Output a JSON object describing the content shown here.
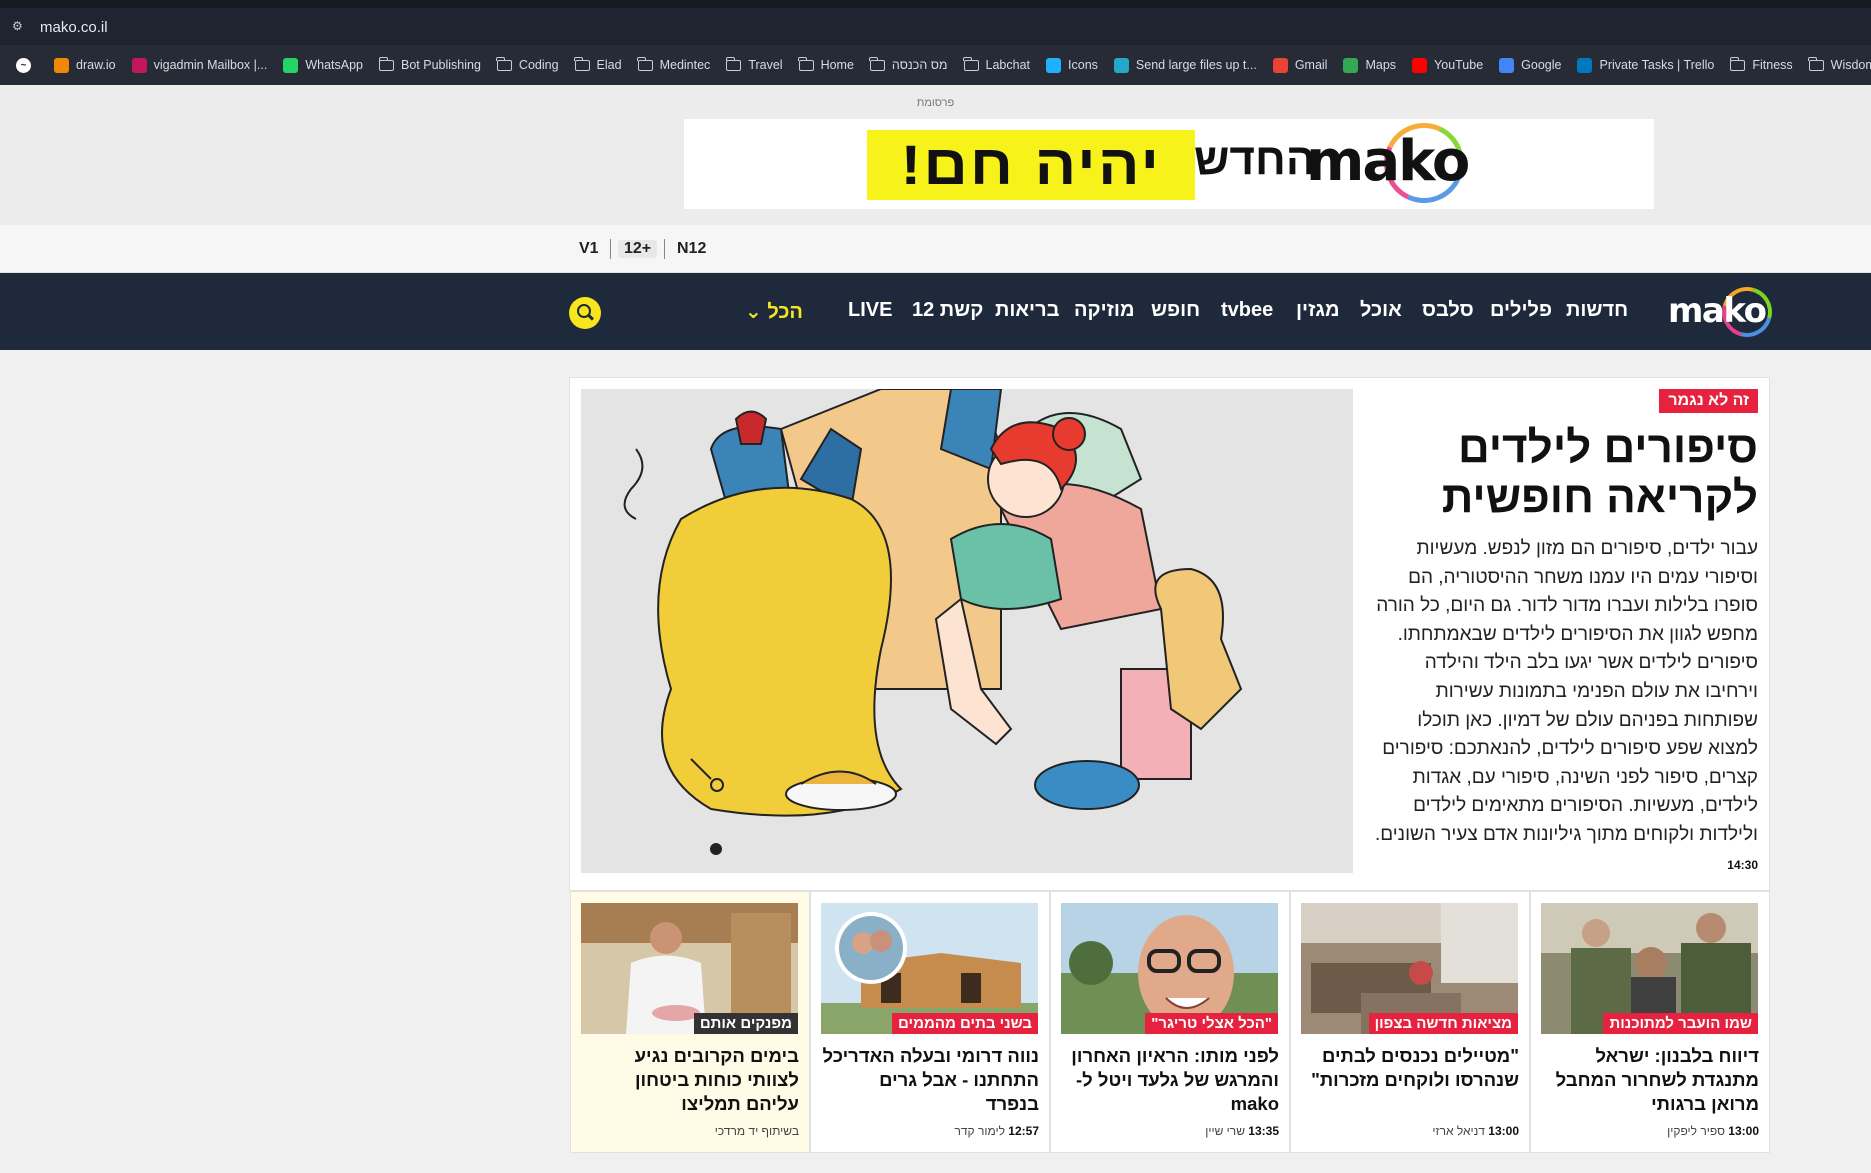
{
  "browser": {
    "url": "mako.co.il",
    "bookmarks": [
      {
        "label": "",
        "icon": "messenger-icon",
        "color": "#ffffff"
      },
      {
        "label": "draw.io",
        "icon": "drawio-icon",
        "color": "#f08705"
      },
      {
        "label": "vigadmin Mailbox |...",
        "icon": "mailbox-icon",
        "color": "#c2185b"
      },
      {
        "label": "WhatsApp",
        "icon": "whatsapp-icon",
        "color": "#25d366"
      },
      {
        "label": "Bot Publishing",
        "icon": "folder-icon"
      },
      {
        "label": "Coding",
        "icon": "folder-icon"
      },
      {
        "label": "Elad",
        "icon": "folder-icon"
      },
      {
        "label": "Medintec",
        "icon": "folder-icon"
      },
      {
        "label": "Travel",
        "icon": "folder-icon"
      },
      {
        "label": "Home",
        "icon": "folder-icon"
      },
      {
        "label": "מס הכנסה",
        "icon": "folder-icon"
      },
      {
        "label": "Labchat",
        "icon": "folder-icon"
      },
      {
        "label": "Icons",
        "icon": "icons8-icon",
        "color": "#1fb0ff"
      },
      {
        "label": "Send large files up t...",
        "icon": "cloud-icon",
        "color": "#23a8c9"
      },
      {
        "label": "Gmail",
        "icon": "gmail-icon",
        "color": "#ea4335"
      },
      {
        "label": "Maps",
        "icon": "maps-icon",
        "color": "#34a853"
      },
      {
        "label": "YouTube",
        "icon": "youtube-icon",
        "color": "#ff0000"
      },
      {
        "label": "Google",
        "icon": "google-icon",
        "color": "#4285f4"
      },
      {
        "label": "Private Tasks | Trello",
        "icon": "trello-icon",
        "color": "#0079bf"
      },
      {
        "label": "Fitness",
        "icon": "folder-icon"
      },
      {
        "label": "Wisdom",
        "icon": "folder-icon"
      }
    ]
  },
  "ad": {
    "label": "פרסומת",
    "yellow_text": "יהיה חם!",
    "hadash": "החדש",
    "brand": "mako"
  },
  "network": {
    "n12": "N12",
    "plus12": "12+",
    "v": "V1"
  },
  "nav": {
    "logo": "mako",
    "items": [
      "חדשות",
      "פלילים",
      "סלבס",
      "אוכל",
      "מגזין",
      "tvbee",
      "חופש",
      "מוזיקה",
      "בריאות",
      "קשת 12",
      "LIVE"
    ],
    "all": "הכל"
  },
  "hero": {
    "tag": "זה לא נגמר",
    "title": "סיפורים לילדים לקריאה חופשית",
    "body": "עבור ילדים, סיפורים הם מזון לנפש. מעשיות וסיפורי עמים היו עמנו משחר ההיסטוריה, הם סופרו בלילות ועברו מדור לדור. גם היום, כל הורה מחפש לגוון את הסיפורים לילדים שבאמתחתו. סיפורים לילדים אשר יגעו בלב הילד והילדה וירחיבו את עולם הפנימי בתמונות עשירות שפותחות בפניהם עולם של דמיון. כאן תוכלו למצוא שפע סיפורים לילדים, להנאתכם: סיפורים קצרים, סיפור לפני השינה, סיפורי עם, אגדות לילדים, מעשיות. הסיפורים מתאימים לילדים ולילדות ולקוחים מתוך גיליונות אדם צעיר השונים.",
    "time": "14:30"
  },
  "cards": [
    {
      "tag": "שמו הועבר למתוכנות",
      "title": "דיווח בלבנון: ישראל מתנגדת לשחרור המחבל מרואן ברגותי",
      "time": "13:00",
      "author": "ספיר ליפקין"
    },
    {
      "tag": "מציאות חדשה בצפון",
      "title": "\"מטיילים נכנסים לבתים שנהרסו ולוקחים מזכרות\"",
      "time": "13:00",
      "author": "דניאל ארזי"
    },
    {
      "tag": "\"הכל אצלי טריגר\"",
      "title": "לפני מותו: הראיון האחרון והמרגש של גלעד ויטל ל-mako",
      "time": "13:35",
      "author": "שרי שיין"
    },
    {
      "tag": "בשני בתים מהממים",
      "title": "נווה דרומי ובעלה האדריכל התחתנו - אבל גרים בנפרד",
      "time": "12:57",
      "author": "לימור קדר"
    },
    {
      "tag": "מפנקים אותם",
      "title": "בימים הקרובים נגיע לצוותי כוחות ביטחון עליהם תמליצו",
      "time": "",
      "author": "בשיתוף יד מרדכי"
    }
  ]
}
